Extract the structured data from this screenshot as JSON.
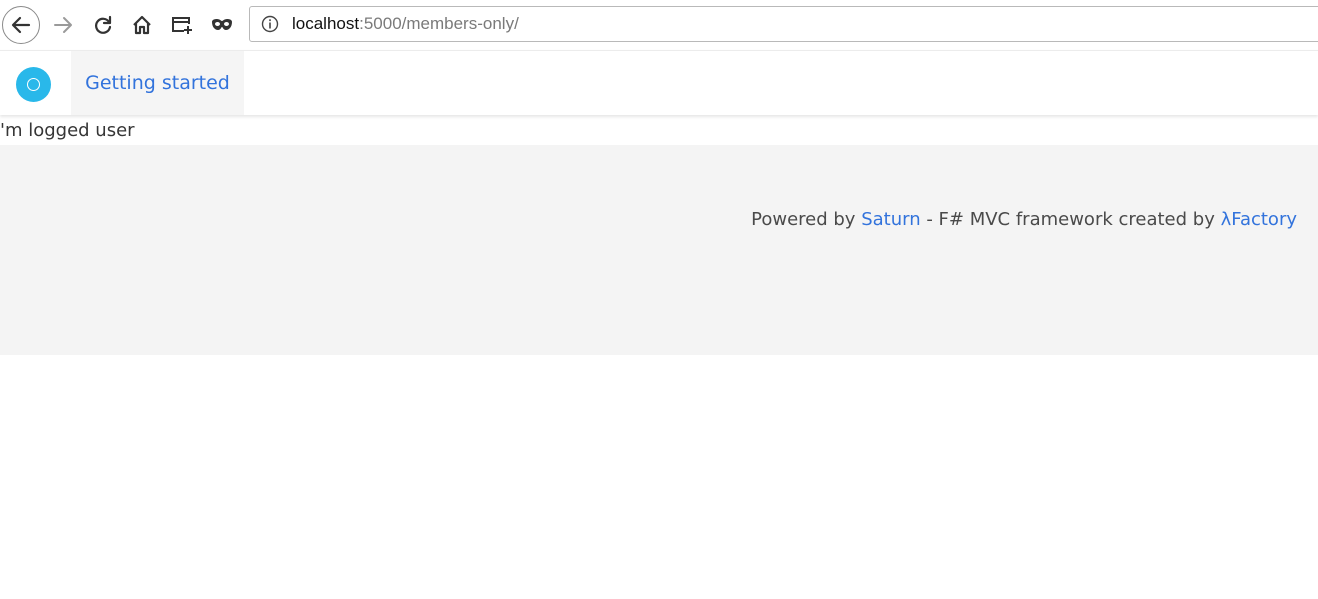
{
  "browser": {
    "url_host": "localhost",
    "url_rest": ":5000/members-only/",
    "icons": {
      "back": "arrow-left-icon",
      "forward": "arrow-right-icon",
      "reload": "reload-icon",
      "home": "home-icon",
      "new_tab": "new-tab-icon",
      "private": "private-mask-icon",
      "site_info": "info-icon"
    }
  },
  "navbar": {
    "items": [
      {
        "label": "Getting started"
      }
    ],
    "logo_color": "#29b8ea",
    "link_color": "#3273dc"
  },
  "main": {
    "text": "'m logged user"
  },
  "footer": {
    "powered_by": "Powered by ",
    "framework_link": "Saturn",
    "middle_text": " - F# MVC framework created by ",
    "author_link": "λFactory",
    "background": "#f4f4f4"
  }
}
